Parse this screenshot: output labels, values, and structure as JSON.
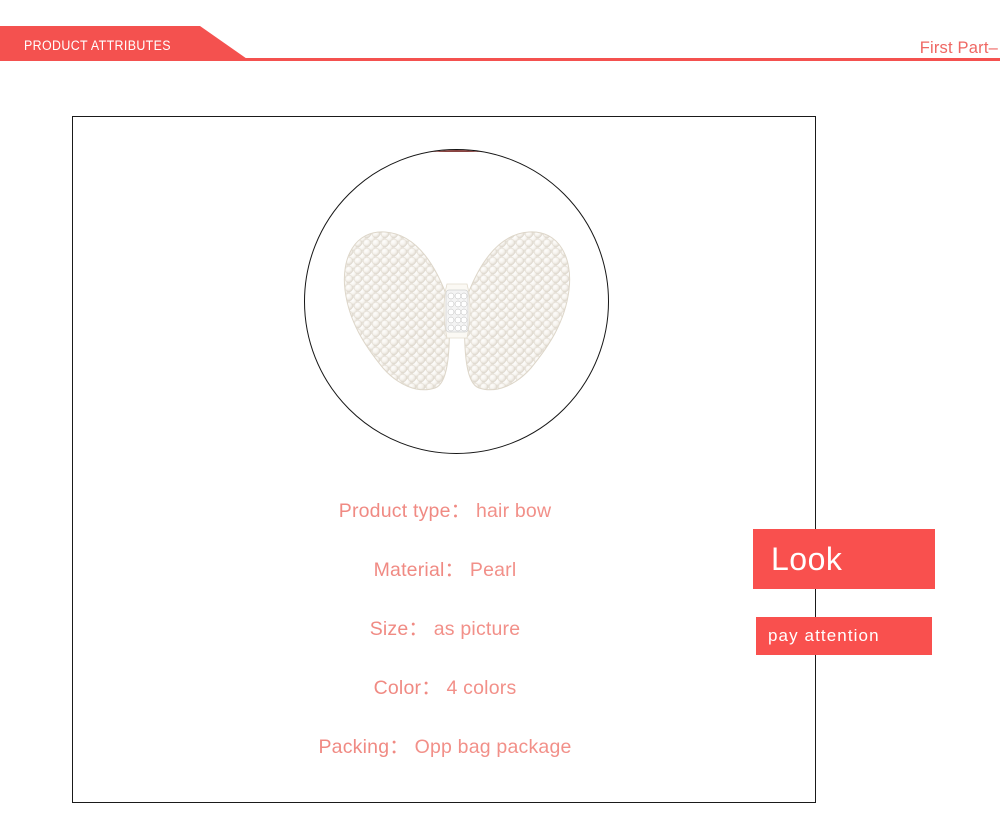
{
  "header": {
    "banner_label": "PRODUCT ATTRIBUTES",
    "right_label": "First Part–",
    "banner_color": "#f4514f",
    "rule_color": "#f4514f",
    "right_label_color": "#ef6763"
  },
  "panel": {
    "border_color": "#1a1a1a",
    "photo": {
      "alt_name": "pearl-beaded-hair-bow",
      "circle_border_color": "#161616"
    },
    "specs": [
      {
        "label": "Product type",
        "separator": "：",
        "value": "hair bow"
      },
      {
        "label": "Material",
        "separator": "：",
        "value": "Pearl"
      },
      {
        "label": "Size",
        "separator": "：",
        "value": "as picture"
      },
      {
        "label": "Color",
        "separator": "：",
        "value": "4 colors"
      },
      {
        "label": "Packing",
        "separator": "：",
        "value": "Opp bag package"
      }
    ],
    "spec_text_color": "#f08a83"
  },
  "badges": {
    "look_label": "Look",
    "attention_label": "pay attention",
    "background_color": "#f9504e",
    "text_color": "#ffffff"
  }
}
